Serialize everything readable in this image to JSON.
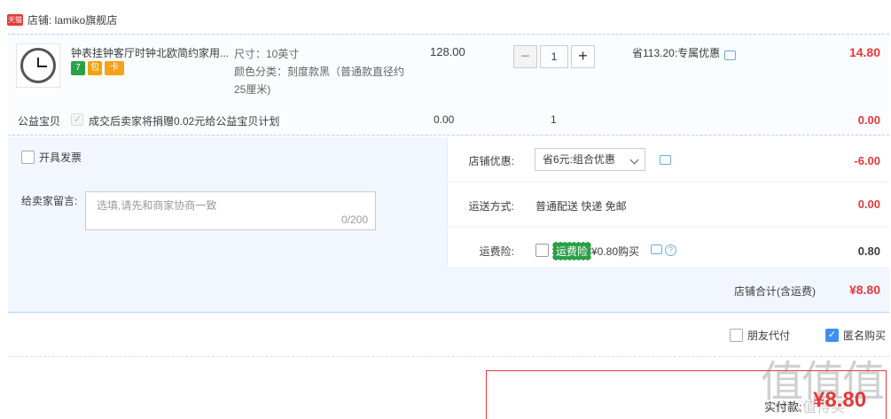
{
  "store": {
    "badge": "天猫",
    "label": "店铺: lamiko旗舰店"
  },
  "item": {
    "title": "钟表挂钟客厅时钟北欧简约家用...",
    "badges": [
      "7",
      "包",
      "卡"
    ],
    "sku": {
      "size": "尺寸：10英寸",
      "color": "颜色分类：刻度款黑（普通款直径约25厘米)"
    },
    "price": "128.00",
    "qty": {
      "minus": "−",
      "value": "1",
      "plus": "+"
    },
    "discount": "省113.20:专属优惠",
    "subtotal": "14.80"
  },
  "charity": {
    "label": "公益宝贝",
    "check_mark": "✓",
    "text": "成交后卖家将捐赠0.02元给公益宝贝计划",
    "price": "0.00",
    "qty": "1",
    "sum": "0.00"
  },
  "order": {
    "invoice_label": "开具发票",
    "remark_label": "给卖家留言:",
    "remark_placeholder": "选填,请先和商家协商一致",
    "remark_count": "0/200",
    "shop_discount_label": "店铺优惠:",
    "shop_discount_select": "省6元:组合优惠",
    "shop_discount_value": "-6.00",
    "shipping_label": "运送方式:",
    "shipping_value": "普通配送 快递 免邮",
    "shipping_sum": "0.00",
    "insurance_label": "运费险:",
    "insurance_tag": "运费险",
    "insurance_text": "¥0.80购买",
    "insurance_help": "?",
    "insurance_value": "0.80",
    "total_label": "店铺合计(含运费)",
    "total_value": "¥8.80"
  },
  "options": {
    "friend_pay": "朋友代付",
    "anonymous_buy": "匿名购买",
    "anonymous_check": "✓"
  },
  "payment": {
    "label": "实付款:",
    "amount": "¥8.80"
  },
  "watermark": {
    "main": "值值值",
    "sub": "什么值得买"
  }
}
